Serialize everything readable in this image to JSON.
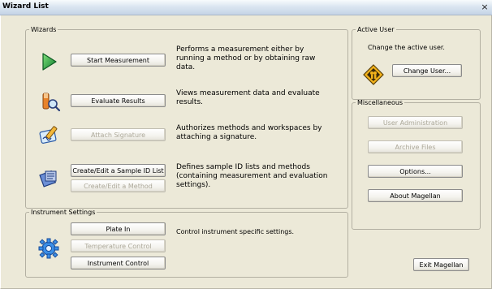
{
  "window": {
    "title": "Wizard List",
    "close_glyph": "×"
  },
  "wizards": {
    "legend": "Wizards",
    "items": [
      {
        "icon": "play-arrow-icon",
        "buttons": [
          "Start Measurement"
        ],
        "disabled": [
          false
        ],
        "description": "Performs a measurement either by running a method or by obtaining raw data."
      },
      {
        "icon": "evaluate-magnifier-icon",
        "buttons": [
          "Evaluate Results"
        ],
        "disabled": [
          false
        ],
        "description": "Views measurement data and evaluate results."
      },
      {
        "icon": "signature-icon",
        "buttons": [
          "Attach Signature"
        ],
        "disabled": [
          true
        ],
        "description": "Authorizes methods and workspaces by attaching a signature."
      },
      {
        "icon": "sample-list-icon",
        "buttons": [
          "Create/Edit a Sample ID List",
          "Create/Edit a Method"
        ],
        "disabled": [
          false,
          true
        ],
        "description": "Defines sample ID lists and methods (containing measurement and evaluation settings)."
      }
    ]
  },
  "instrument": {
    "legend": "Instrument Settings",
    "icon": "gear-icon",
    "buttons": [
      "Plate In",
      "Temperature Control",
      "Instrument Control"
    ],
    "disabled": [
      false,
      true,
      false
    ],
    "description": "Control instrument specific settings."
  },
  "active_user": {
    "legend": "Active User",
    "text": "Change the active user.",
    "icon": "user-diamond-icon",
    "button": "Change User..."
  },
  "misc": {
    "legend": "Miscellaneous",
    "buttons": [
      "User Administration",
      "Archive Files",
      "Options...",
      "About Magellan"
    ],
    "disabled": [
      true,
      true,
      false,
      false
    ]
  },
  "exit_button": "Exit Magellan",
  "colors": {
    "background": "#ece9d8",
    "disabled_text": "#aca899",
    "accent_green": "#1a9a3a",
    "accent_blue": "#2f6fd0"
  }
}
